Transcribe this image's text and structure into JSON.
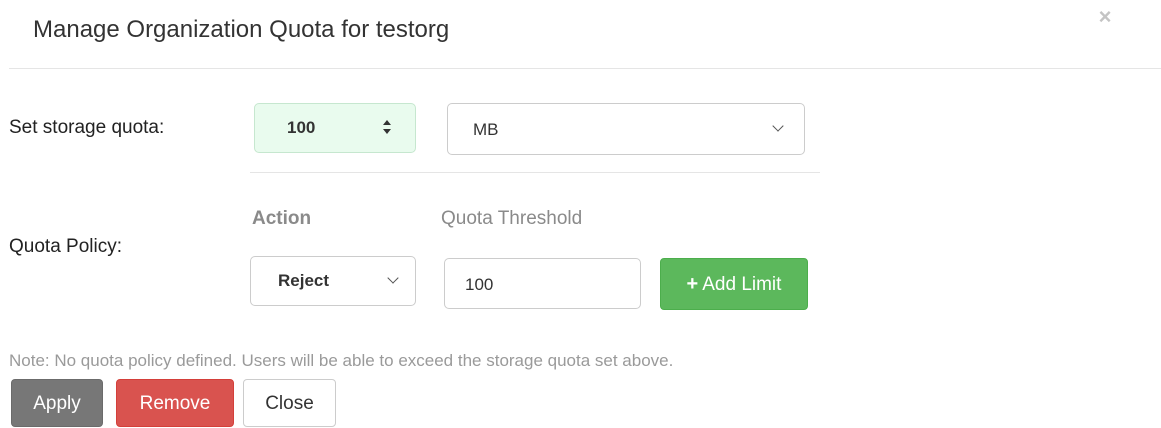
{
  "dialog": {
    "title": "Manage Organization Quota for testorg",
    "close_glyph": "×"
  },
  "storage": {
    "label": "Set storage quota:",
    "quota_value": "100",
    "unit_selected": "MB"
  },
  "policy": {
    "label": "Quota Policy:",
    "column_action": "Action",
    "column_threshold": "Quota Threshold",
    "action_selected": "Reject",
    "threshold_value": "100",
    "add_limit_icon": "+",
    "add_limit_label": "Add Limit"
  },
  "note": "Note: No quota policy defined. Users will be able to exceed the storage quota set above.",
  "footer": {
    "apply_label": "Apply",
    "remove_label": "Remove",
    "close_label": "Close"
  },
  "colors": {
    "success": "#5cb85c",
    "danger": "#d9534f",
    "default_dark": "#777777",
    "input_valid_bg": "#e9fbee"
  }
}
